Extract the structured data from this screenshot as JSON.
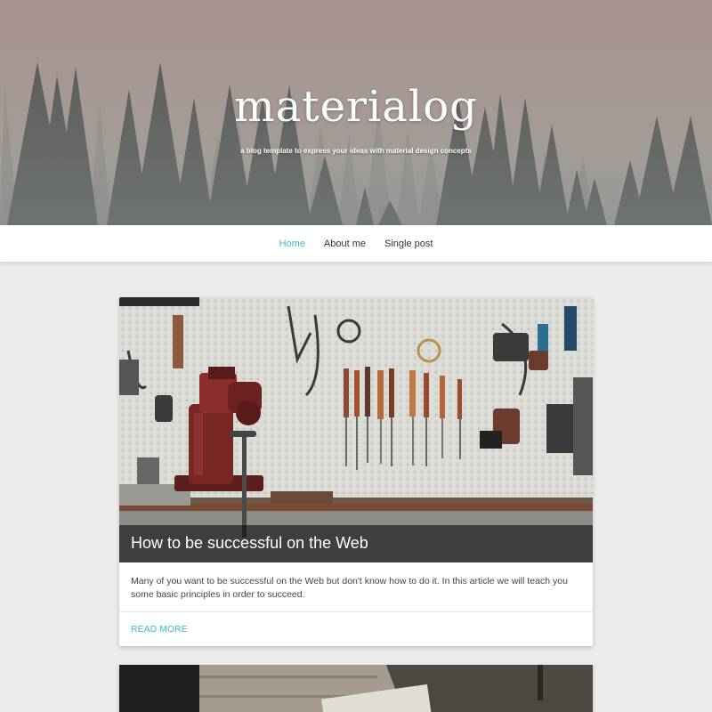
{
  "site": {
    "title": "materialog",
    "tagline": "a blog template to express your ideas with material design concepts"
  },
  "nav": {
    "items": [
      {
        "label": "Home",
        "active": true
      },
      {
        "label": "About me",
        "active": false
      },
      {
        "label": "Single post",
        "active": false
      }
    ]
  },
  "posts": [
    {
      "title": "How to be successful on the Web",
      "excerpt": "Many of you want to be successful on the Web but don't know how to do it. In this article we will teach you some basic principles in order to succeed.",
      "action_label": "READ MORE",
      "image": "workshop-tools-vise"
    },
    {
      "image": "wooden-desk-laptop"
    }
  ],
  "colors": {
    "accent": "#3cb8d8",
    "page_background": "#ebebeb",
    "card_background": "#ffffff"
  }
}
